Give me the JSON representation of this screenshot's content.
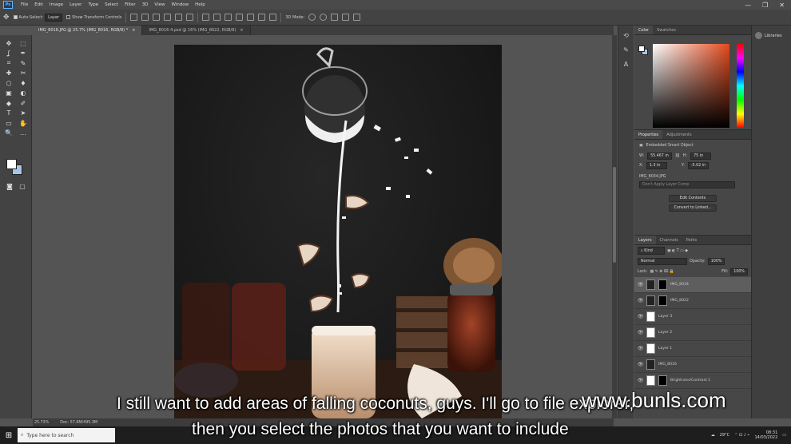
{
  "menu": {
    "logo": "Ps",
    "items": [
      "File",
      "Edit",
      "Image",
      "Layer",
      "Type",
      "Select",
      "Filter",
      "3D",
      "View",
      "Window",
      "Help"
    ],
    "window_controls": [
      "—",
      "❐",
      "✕"
    ]
  },
  "options_bar": {
    "auto_select_label": "Auto-Select:",
    "auto_select_value": "Layer",
    "transform_label": "Show Transform Controls",
    "mode_label": "3D Mode:"
  },
  "tabs": [
    {
      "label": "IMG_8016.JPG @ 25.7% (IMG_8016, RGB/8) *",
      "close": "×"
    },
    {
      "label": "IMG_8016-4.psd @ 16% (IMG_8022, RGB/8)",
      "close": "×"
    }
  ],
  "toolbar": {
    "tools": [
      "✥",
      "⬚",
      "ʆ",
      "✒",
      "⌗",
      "✎",
      "✚",
      "✂",
      "⬡",
      "♦",
      "▣",
      "◐",
      "◆",
      "✐",
      "T",
      "➤",
      "▭",
      "✋",
      "🔍",
      "…"
    ]
  },
  "panels": {
    "color_tabs": [
      "Color",
      "Swatches"
    ],
    "props_tabs": [
      "Properties",
      "Adjustments"
    ],
    "props_title": "Embedded Smart Object",
    "w_label": "W:",
    "w_value": "55.467 in",
    "h_label": "H:",
    "h_value": "75 in",
    "x_label": "X:",
    "x_value": "1.3 in",
    "y_label": "Y:",
    "y_value": "-5.02 in",
    "file_name": "IMG_8034.JPG",
    "comp_placeholder": "Don't Apply Layer Comp",
    "edit_btn": "Edit Contents",
    "convert_btn": "Convert to Linked...",
    "layers_tabs": [
      "Layers",
      "Channels",
      "Paths"
    ],
    "kind_label": "Kind",
    "blend_mode": "Normal",
    "opacity_label": "Opacity:",
    "opacity_value": "100%",
    "lock_label": "Lock:",
    "fill_label": "Fill:",
    "fill_value": "100%",
    "layers": [
      {
        "name": "IMG_8034",
        "selected": true,
        "thumb": "dark",
        "mask": true
      },
      {
        "name": "IMG_8022",
        "selected": false,
        "thumb": "dark",
        "mask": true
      },
      {
        "name": "Layer 3",
        "selected": false,
        "thumb": "light",
        "mask": false
      },
      {
        "name": "Layer 2",
        "selected": false,
        "thumb": "light",
        "mask": false
      },
      {
        "name": "Layer 1",
        "selected": false,
        "thumb": "light",
        "mask": false
      },
      {
        "name": "IMG_8016",
        "selected": false,
        "thumb": "dark",
        "mask": false
      },
      {
        "name": "Brightness/Contrast 1",
        "selected": false,
        "thumb": "light",
        "mask": true
      }
    ]
  },
  "libraries_label": "Libraries",
  "status": {
    "zoom": "25.73%",
    "doc": "Doc: 57.6M/495.3M"
  },
  "taskbar": {
    "search_placeholder": "Type here to search",
    "weather": "29°C",
    "time": "08:31",
    "date": "14/03/2022"
  },
  "subtitles": {
    "line1": "I still want to add areas of falling coconuts, guys. I'll go to file explorer,",
    "line2": "then you select the photos that you want to include"
  },
  "watermark": "www.bunls.com"
}
